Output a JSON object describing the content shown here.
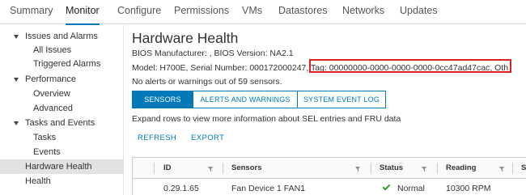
{
  "tabs": [
    "Summary",
    "Monitor",
    "Configure",
    "Permissions",
    "VMs",
    "Datastores",
    "Networks",
    "Updates"
  ],
  "active_tab": "Monitor",
  "nav": {
    "issues": "Issues and Alarms",
    "all_issues": "All Issues",
    "triggered_alarms": "Triggered Alarms",
    "performance": "Performance",
    "overview": "Overview",
    "advanced": "Advanced",
    "tasks_events": "Tasks and Events",
    "tasks": "Tasks",
    "events": "Events",
    "hardware_health": "Hardware Health",
    "health": "Health"
  },
  "selected_nav": "Hardware Health",
  "main": {
    "title": "Hardware Health",
    "bios": "BIOS Manufacturer: , BIOS Version: NA2.1",
    "model": "Model: H700E, Serial Number: 000172000247, ",
    "tag": "Tag: 00000000-0000-0000-0000-0cc47ad47cac",
    "tag_suffix": ", Oth",
    "alerts": "No alerts or warnings out of 59 sensors.",
    "hint": "Expand rows to view more information about SEL entries and FRU data",
    "refresh": "REFRESH",
    "export": "EXPORT"
  },
  "segments": [
    {
      "label": "SENSORS",
      "active": true
    },
    {
      "label": "ALERTS AND WARNINGS",
      "active": false
    },
    {
      "label": "SYSTEM EVENT LOG",
      "active": false
    }
  ],
  "table": {
    "columns": [
      "ID",
      "Sensors",
      "Status",
      "Reading",
      "S"
    ],
    "rows": [
      {
        "id": "0.29.1.65",
        "sensor": "Fan Device 1 FAN1",
        "status": "Normal",
        "reading": "10300 RPM"
      }
    ]
  },
  "colors": {
    "accent": "#0079b8",
    "highlight_box": "#e02020",
    "status_ok": "#3f9c35",
    "selected_nav_bg": "#e2e2e2"
  }
}
